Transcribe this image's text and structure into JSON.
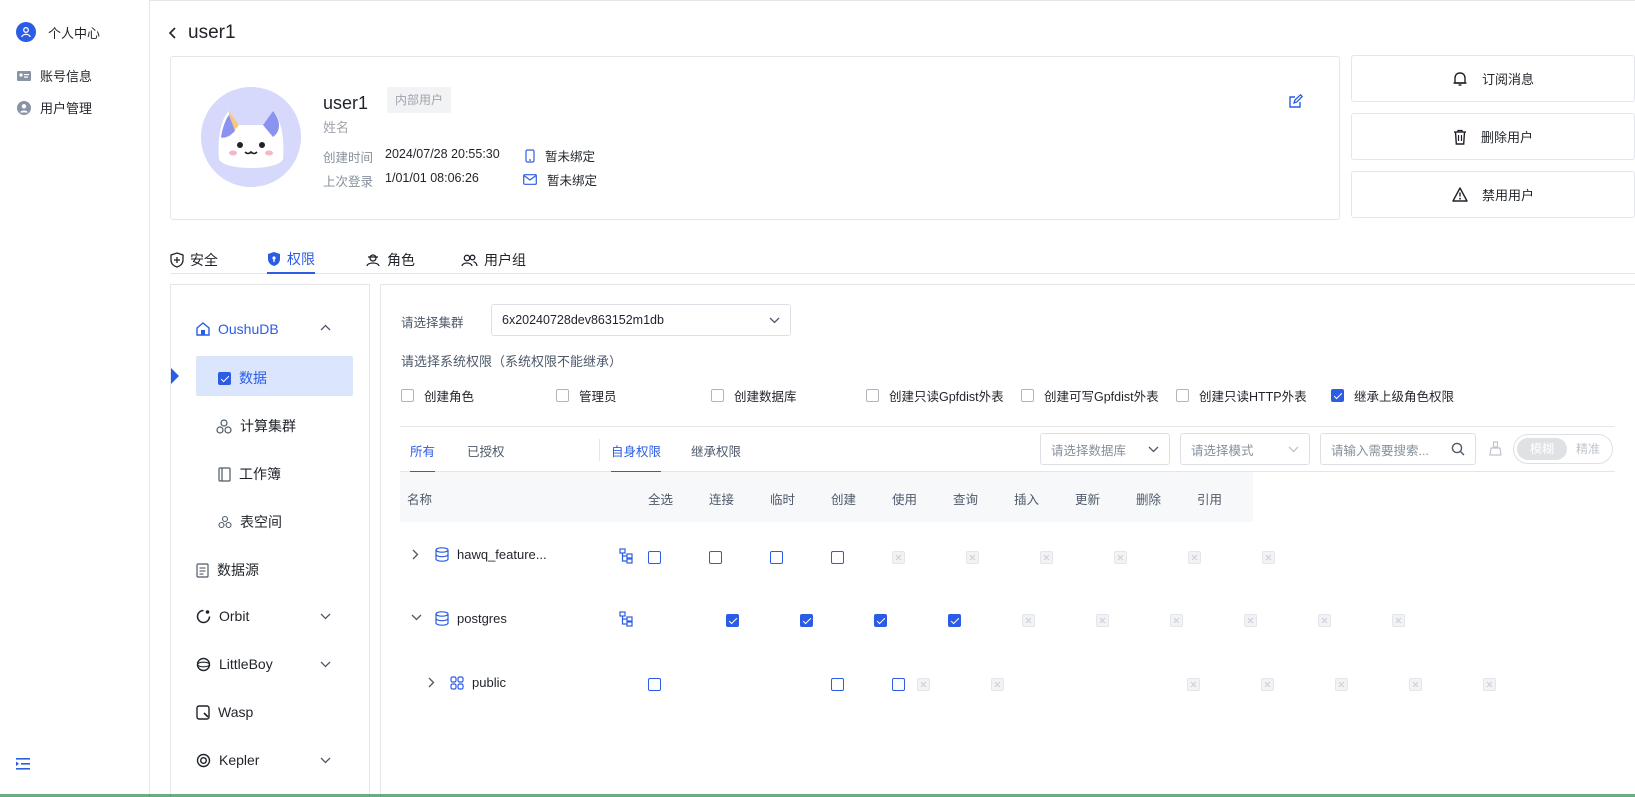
{
  "sidebar": {
    "header": "个人中心",
    "items": [
      {
        "label": "账号信息",
        "icon": "id-card-icon"
      },
      {
        "label": "用户管理",
        "icon": "user-circle-icon"
      }
    ]
  },
  "page": {
    "title": "user1"
  },
  "profile": {
    "username": "user1",
    "tag": "内部用户",
    "name_placeholder": "姓名",
    "created_label": "创建时间",
    "created_value": "2024/07/28 20:55:30",
    "last_login_label": "上次登录",
    "last_login_value": "1/01/01 08:06:26",
    "phone_status": "暂未绑定",
    "email_status": "暂未绑定"
  },
  "actions": {
    "subscribe": "订阅消息",
    "delete": "删除用户",
    "disable": "禁用用户"
  },
  "tabs": [
    "安全",
    "权限",
    "角色",
    "用户组"
  ],
  "tree": {
    "root": "OushuDB",
    "items": [
      "数据",
      "计算集群",
      "工作簿",
      "表空间"
    ],
    "others": [
      "数据源",
      "Orbit",
      "LittleBoy",
      "Wasp",
      "Kepler"
    ]
  },
  "form": {
    "cluster_label": "请选择集群",
    "cluster_value": "6x20240728dev863152m1db",
    "sys_perm_label": "请选择系统权限（系统权限不能继承）",
    "sys_perms": [
      {
        "label": "创建角色",
        "checked": false
      },
      {
        "label": "管理员",
        "checked": false
      },
      {
        "label": "创建数据库",
        "checked": false
      },
      {
        "label": "创建只读Gpfdist外表",
        "checked": false
      },
      {
        "label": "创建可写Gpfdist外表",
        "checked": false
      },
      {
        "label": "创建只读HTTP外表",
        "checked": false
      },
      {
        "label": "继承上级角色权限",
        "checked": true
      }
    ]
  },
  "filter": {
    "tabs_left": [
      "所有",
      "已授权"
    ],
    "tabs_right": [
      "自身权限",
      "继承权限"
    ],
    "db_placeholder": "请选择数据库",
    "schema_placeholder": "请选择模式",
    "search_placeholder": "请输入需要搜索...",
    "toggle_on": "模糊",
    "toggle_off": "精准"
  },
  "table": {
    "columns": [
      "名称",
      "全选",
      "连接",
      "临时",
      "创建",
      "使用",
      "查询",
      "插入",
      "更新",
      "删除",
      "引用"
    ],
    "rows": [
      {
        "name": "hawq_feature...",
        "states": [
          "empty",
          "empty",
          "empty",
          "empty",
          "dis",
          "dis",
          "dis",
          "dis",
          "dis",
          "dis"
        ]
      },
      {
        "name": "postgres",
        "states": [
          "on",
          "on",
          "on",
          "on",
          "dis",
          "dis",
          "dis",
          "dis",
          "dis",
          "dis"
        ]
      },
      {
        "name": "public",
        "states": [
          "empty",
          "dis",
          "dis",
          "empty",
          "empty",
          "dis",
          "dis",
          "dis",
          "dis",
          "dis"
        ]
      }
    ]
  },
  "colors": {
    "accent": "#2b5ce6"
  }
}
